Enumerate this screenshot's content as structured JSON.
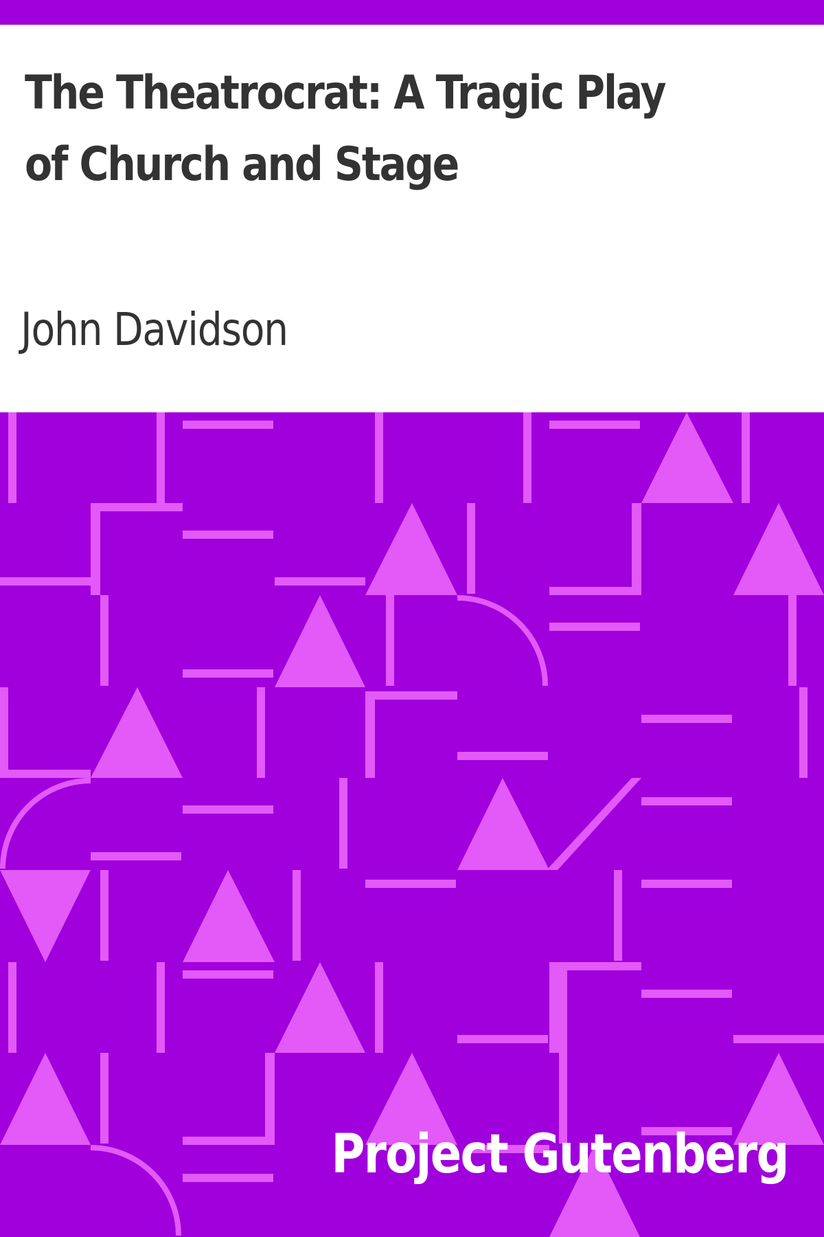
{
  "cover": {
    "title": "The Theatrocrat: A Tragic Play of Church and Stage",
    "author": "John Davidson",
    "publisher": "Project Gutenberg"
  },
  "colors": {
    "background": "#ffffff",
    "accent": "#a000dc",
    "pattern": "#e35af8",
    "text": "#333333",
    "publisher_text": "#ffffff"
  }
}
